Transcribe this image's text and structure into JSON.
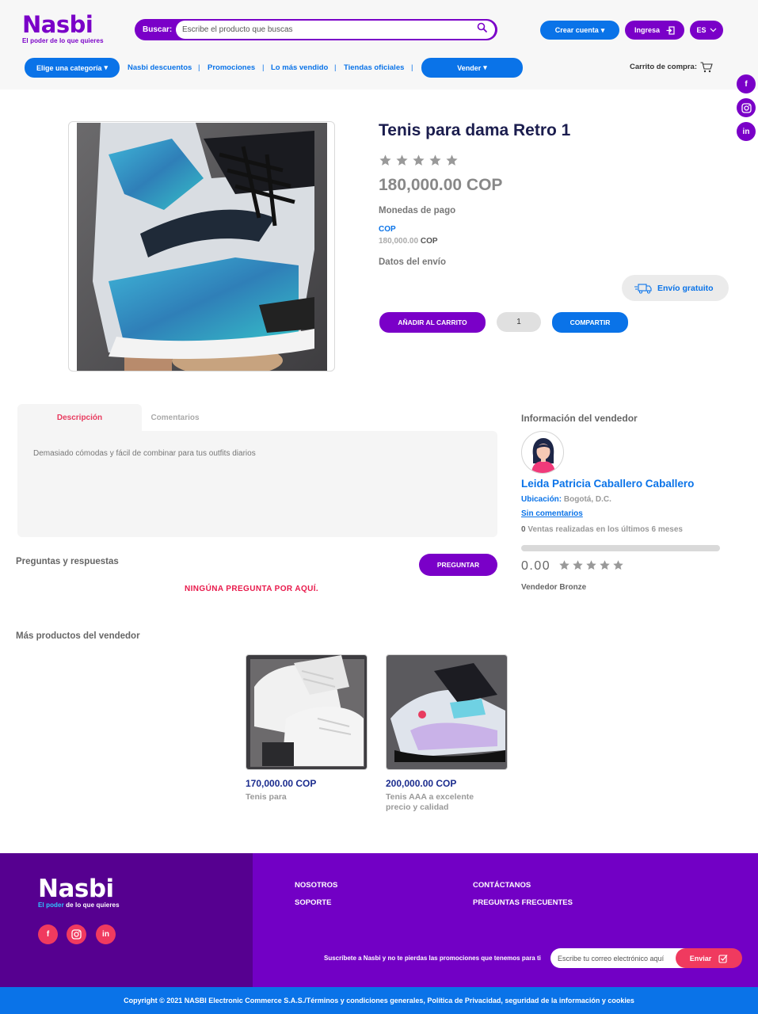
{
  "brand": {
    "name": "Nasbi",
    "tagline": "El poder de lo que quieres",
    "tagline_highlight": "El poder",
    "tagline_rest": "de lo que quieres"
  },
  "header": {
    "search_label": "Buscar:",
    "search_placeholder": "Escribe el producto que buscas",
    "create_account": "Crear cuenta",
    "login": "Ingresa",
    "language": "ES",
    "category_button": "Elige una categoría",
    "nav_links": [
      "Nasbi descuentos",
      "Promociones",
      "Lo más vendido",
      "Tiendas oficiales"
    ],
    "sell_button": "Vender",
    "cart_label": "Carrito de compra:"
  },
  "product": {
    "title": "Tenis para dama Retro 1",
    "rating": 0,
    "price": "180,000.00 COP",
    "payment_label": "Monedas de pago",
    "payment_currency": "COP",
    "payment_amount": "180,000.00",
    "payment_amount_currency": "COP",
    "shipping_label": "Datos del envío",
    "shipping_badge": "Envío gratuito",
    "add_to_cart": "AÑADIR AL CARRITO",
    "quantity": "1",
    "share": "COMPARTIR"
  },
  "tabs": {
    "description": "Descripción",
    "comments": "Comentarios",
    "description_text": "Demasiado cómodas y fácil de combinar para tus outfits diarios"
  },
  "qa": {
    "title": "Preguntas y respuestas",
    "ask_button": "PREGUNTAR",
    "empty": "NINGÚNA PREGUNTA POR AQUÍ."
  },
  "seller": {
    "section_title": "Información del vendedor",
    "name": "Leida Patricia Caballero Caballero",
    "location_label": "Ubicación:",
    "location": "Bogotá, D.C.",
    "comments_link": "Sin comentarios",
    "sales_count": "0",
    "sales_text": "Ventas realizadas en los últimos 6 meses",
    "rating_value": "0.00",
    "rating_progress": 0,
    "level": "Vendedor Bronze"
  },
  "more_products": {
    "title": "Más productos del vendedor",
    "items": [
      {
        "price": "170,000.00 COP",
        "name": "Tenis para"
      },
      {
        "price": "200,000.00 COP",
        "name": "Tenis AAA a excelente precio y calidad"
      }
    ]
  },
  "footer": {
    "links": [
      "NOSOTROS",
      "SOPORTE",
      "CONTÁCTANOS",
      "PREGUNTAS FRECUENTES"
    ],
    "subscribe_text": "Suscríbete a Nasbi y no te pierdas las promociones que tenemos para ti",
    "email_placeholder": "Escribe tu correo electrónico aquí",
    "send_button": "Enviar",
    "copyright": "Copyright © 2021 NASBI Electronic Commerce S.A.S./Términos y condiciones generales, Política de Privacidad, seguridad de la información y cookies"
  },
  "social": {
    "facebook": "f",
    "instagram": "instagram-icon",
    "linkedin": "in"
  },
  "colors": {
    "purple": "#7a00c8",
    "blue": "#0a73e8",
    "pink": "#f03a5f",
    "navy": "#1b1d4e"
  }
}
